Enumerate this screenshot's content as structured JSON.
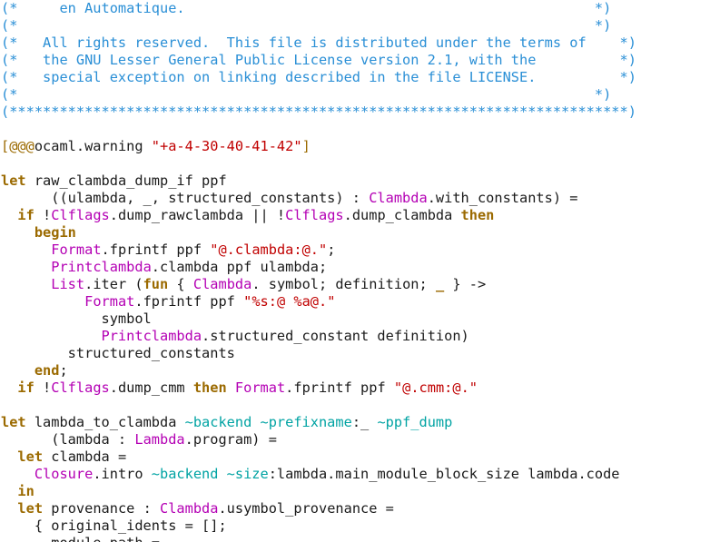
{
  "colors": {
    "background": "#ffffff",
    "text": "#1a1a1a",
    "comment": "#2a8fd6",
    "keyword": "#9b6a00",
    "module": "#b400b4",
    "string": "#c00000",
    "label": "#00a3a3"
  },
  "lines": [
    [
      {
        "c": "cmt",
        "t": "(*     en Automatique.                                                 *)"
      }
    ],
    [
      {
        "c": "cmt",
        "t": "(*                                                                     *)"
      }
    ],
    [
      {
        "c": "cmt",
        "t": "(*   All rights reserved.  This file is distributed under the terms of    *)"
      }
    ],
    [
      {
        "c": "cmt",
        "t": "(*   the GNU Lesser General Public License version 2.1, with the          *)"
      }
    ],
    [
      {
        "c": "cmt",
        "t": "(*   special exception on linking described in the file LICENSE.          *)"
      }
    ],
    [
      {
        "c": "cmt",
        "t": "(*                                                                     *)"
      }
    ],
    [
      {
        "c": "cmt",
        "t": "(**************************************************************************)"
      }
    ],
    [],
    [
      {
        "c": "attr",
        "t": "[@@@"
      },
      {
        "c": "",
        "t": "ocaml.warning "
      },
      {
        "c": "str",
        "t": "\"+a-4-30-40-41-42\""
      },
      {
        "c": "attr",
        "t": "]"
      }
    ],
    [],
    [
      {
        "c": "kw",
        "t": "let"
      },
      {
        "c": "",
        "t": " raw_clambda_dump_if ppf"
      }
    ],
    [
      {
        "c": "",
        "t": "      ((ulambda, _, structured_constants) : "
      },
      {
        "c": "mod",
        "t": "Clambda"
      },
      {
        "c": "",
        "t": ".with_constants) ="
      }
    ],
    [
      {
        "c": "",
        "t": "  "
      },
      {
        "c": "kw",
        "t": "if"
      },
      {
        "c": "",
        "t": " !"
      },
      {
        "c": "mod",
        "t": "Clflags"
      },
      {
        "c": "",
        "t": ".dump_rawclambda || !"
      },
      {
        "c": "mod",
        "t": "Clflags"
      },
      {
        "c": "",
        "t": ".dump_clambda "
      },
      {
        "c": "kw",
        "t": "then"
      }
    ],
    [
      {
        "c": "",
        "t": "    "
      },
      {
        "c": "kw",
        "t": "begin"
      }
    ],
    [
      {
        "c": "",
        "t": "      "
      },
      {
        "c": "mod",
        "t": "Format"
      },
      {
        "c": "",
        "t": ".fprintf ppf "
      },
      {
        "c": "str",
        "t": "\"@.clambda:@.\""
      },
      {
        "c": "",
        "t": ";"
      }
    ],
    [
      {
        "c": "",
        "t": "      "
      },
      {
        "c": "mod",
        "t": "Printclambda"
      },
      {
        "c": "",
        "t": ".clambda ppf ulambda;"
      }
    ],
    [
      {
        "c": "",
        "t": "      "
      },
      {
        "c": "mod",
        "t": "List"
      },
      {
        "c": "",
        "t": ".iter ("
      },
      {
        "c": "kw",
        "t": "fun"
      },
      {
        "c": "",
        "t": " { "
      },
      {
        "c": "mod",
        "t": "Clambda"
      },
      {
        "c": "",
        "t": ". symbol; definition; "
      },
      {
        "c": "kw",
        "t": "_"
      },
      {
        "c": "",
        "t": " } ->"
      }
    ],
    [
      {
        "c": "",
        "t": "          "
      },
      {
        "c": "mod",
        "t": "Format"
      },
      {
        "c": "",
        "t": ".fprintf ppf "
      },
      {
        "c": "str",
        "t": "\"%s:@ %a@.\""
      }
    ],
    [
      {
        "c": "",
        "t": "            symbol"
      }
    ],
    [
      {
        "c": "",
        "t": "            "
      },
      {
        "c": "mod",
        "t": "Printclambda"
      },
      {
        "c": "",
        "t": ".structured_constant definition)"
      }
    ],
    [
      {
        "c": "",
        "t": "        structured_constants"
      }
    ],
    [
      {
        "c": "",
        "t": "    "
      },
      {
        "c": "kw",
        "t": "end"
      },
      {
        "c": "",
        "t": ";"
      }
    ],
    [
      {
        "c": "",
        "t": "  "
      },
      {
        "c": "kw",
        "t": "if"
      },
      {
        "c": "",
        "t": " !"
      },
      {
        "c": "mod",
        "t": "Clflags"
      },
      {
        "c": "",
        "t": ".dump_cmm "
      },
      {
        "c": "kw",
        "t": "then"
      },
      {
        "c": "",
        "t": " "
      },
      {
        "c": "mod",
        "t": "Format"
      },
      {
        "c": "",
        "t": ".fprintf ppf "
      },
      {
        "c": "str",
        "t": "\"@.cmm:@.\""
      }
    ],
    [],
    [
      {
        "c": "kw",
        "t": "let"
      },
      {
        "c": "",
        "t": " lambda_to_clambda "
      },
      {
        "c": "lbl",
        "t": "~backend ~prefixname"
      },
      {
        "c": "",
        "t": ":_ "
      },
      {
        "c": "lbl",
        "t": "~ppf_dump"
      }
    ],
    [
      {
        "c": "",
        "t": "      (lambda : "
      },
      {
        "c": "mod",
        "t": "Lambda"
      },
      {
        "c": "",
        "t": ".program) ="
      }
    ],
    [
      {
        "c": "",
        "t": "  "
      },
      {
        "c": "kw",
        "t": "let"
      },
      {
        "c": "",
        "t": " clambda ="
      }
    ],
    [
      {
        "c": "",
        "t": "    "
      },
      {
        "c": "mod",
        "t": "Closure"
      },
      {
        "c": "",
        "t": ".intro "
      },
      {
        "c": "lbl",
        "t": "~backend ~size"
      },
      {
        "c": "",
        "t": ":lambda.main_module_block_size lambda.code"
      }
    ],
    [
      {
        "c": "",
        "t": "  "
      },
      {
        "c": "kw",
        "t": "in"
      }
    ],
    [
      {
        "c": "",
        "t": "  "
      },
      {
        "c": "kw",
        "t": "let"
      },
      {
        "c": "",
        "t": " provenance : "
      },
      {
        "c": "mod",
        "t": "Clambda"
      },
      {
        "c": "",
        "t": ".usymbol_provenance ="
      }
    ],
    [
      {
        "c": "",
        "t": "    { original_idents = [];"
      }
    ],
    [
      {
        "c": "",
        "t": "      module_path ="
      }
    ]
  ]
}
